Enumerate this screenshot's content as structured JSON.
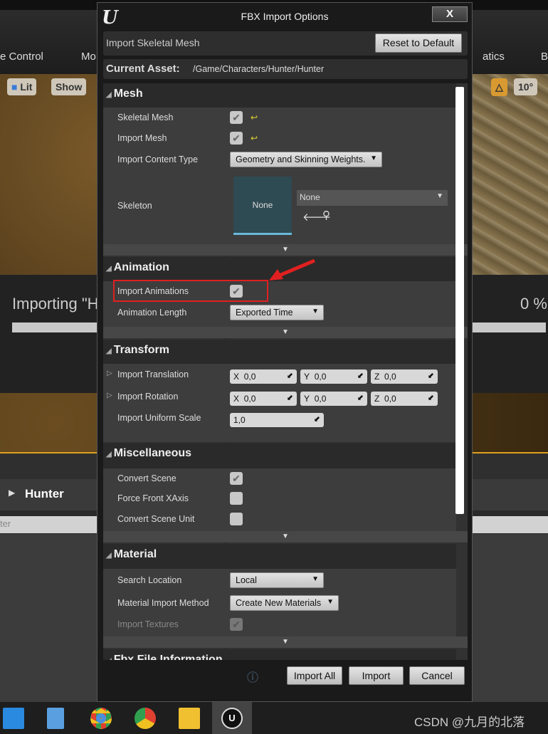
{
  "background": {
    "toolbar_left": "e Control",
    "toolbar_mid": "Mo",
    "toolbar_right": "atics",
    "toolbar_far": "B",
    "lit": "Lit",
    "show": "Show",
    "snap_value": "10°",
    "snap_left": "0",
    "importing": "Importing \"H",
    "percent": "0 %",
    "hunter": "Hunter",
    "filter": "ter",
    "progress": 0
  },
  "dialog": {
    "title": "FBX Import Options",
    "close": "X",
    "import_type": "Import Skeletal Mesh",
    "reset_default": "Reset to Default",
    "current_asset_label": "Current Asset:",
    "current_asset_path": "/Game/Characters/Hunter/Hunter",
    "mesh": {
      "header": "Mesh",
      "skeletal_mesh": "Skeletal Mesh",
      "import_mesh": "Import Mesh",
      "content_type_label": "Import Content Type",
      "content_type": "Geometry and Skinning Weights.",
      "skeleton_label": "Skeleton",
      "skeleton_thumb": "None",
      "skeleton_value": "None"
    },
    "animation": {
      "header": "Animation",
      "import_animations": "Import Animations",
      "length_label": "Animation Length",
      "length": "Exported Time"
    },
    "transform": {
      "header": "Transform",
      "translation": "Import Translation",
      "rotation": "Import Rotation",
      "scale_label": "Import Uniform Scale",
      "tx": "0,0",
      "ty": "0,0",
      "tz": "0,0",
      "rx": "0,0",
      "ry": "0,0",
      "rz": "0,0",
      "scale": "1,0",
      "x": "X",
      "y": "Y",
      "z": "Z"
    },
    "misc": {
      "header": "Miscellaneous",
      "convert_scene": "Convert Scene",
      "force_front": "Force Front XAxis",
      "convert_unit": "Convert Scene Unit"
    },
    "material": {
      "header": "Material",
      "search_label": "Search Location",
      "search": "Local",
      "method_label": "Material Import Method",
      "method": "Create New Materials",
      "textures": "Import Textures"
    },
    "fbx_info": {
      "header": "Fbx File Information"
    },
    "buttons": {
      "import_all": "Import All",
      "import": "Import",
      "cancel": "Cancel"
    },
    "checks": {
      "skeletal_mesh": true,
      "import_mesh": true,
      "import_animations": true,
      "convert_scene": true,
      "force_front": false,
      "convert_unit": false,
      "import_textures": true
    }
  },
  "annotation": {
    "color": "#e02020"
  },
  "taskbar": {
    "watermark": "CSDN @九月的北落"
  }
}
